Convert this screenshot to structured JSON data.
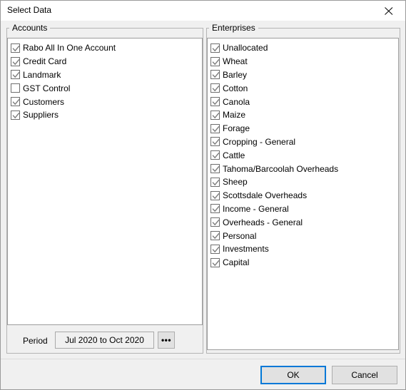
{
  "window": {
    "title": "Select Data",
    "close_icon": "close-icon"
  },
  "accounts": {
    "group_label": "Accounts",
    "items": [
      {
        "label": "Rabo All In One Account",
        "checked": true
      },
      {
        "label": "Credit Card",
        "checked": true
      },
      {
        "label": "Landmark",
        "checked": true
      },
      {
        "label": "GST Control",
        "checked": false
      },
      {
        "label": "Customers",
        "checked": true
      },
      {
        "label": "Suppliers",
        "checked": true
      }
    ]
  },
  "enterprises": {
    "group_label": "Enterprises",
    "items": [
      {
        "label": "Unallocated",
        "checked": true
      },
      {
        "label": "Wheat",
        "checked": true
      },
      {
        "label": "Barley",
        "checked": true
      },
      {
        "label": "Cotton",
        "checked": true
      },
      {
        "label": "Canola",
        "checked": true
      },
      {
        "label": "Maize",
        "checked": true
      },
      {
        "label": "Forage",
        "checked": true
      },
      {
        "label": "Cropping - General",
        "checked": true
      },
      {
        "label": "Cattle",
        "checked": true
      },
      {
        "label": "Tahoma/Barcoolah Overheads",
        "checked": true
      },
      {
        "label": "Sheep",
        "checked": true
      },
      {
        "label": "Scottsdale Overheads",
        "checked": true
      },
      {
        "label": "Income - General",
        "checked": true
      },
      {
        "label": "Overheads - General",
        "checked": true
      },
      {
        "label": "Personal",
        "checked": true
      },
      {
        "label": "Investments",
        "checked": true
      },
      {
        "label": "Capital",
        "checked": true
      }
    ]
  },
  "period": {
    "label": "Period",
    "value": "Jul 2020 to Oct 2020",
    "browse_label": "•••"
  },
  "footer": {
    "ok_label": "OK",
    "cancel_label": "Cancel"
  },
  "colors": {
    "accent": "#0078d7",
    "dialog_background": "#f0f0f0",
    "panel_background": "#ffffff",
    "checkbox_border": "#6e6e6e",
    "check_mark": "#7c7c7c"
  }
}
